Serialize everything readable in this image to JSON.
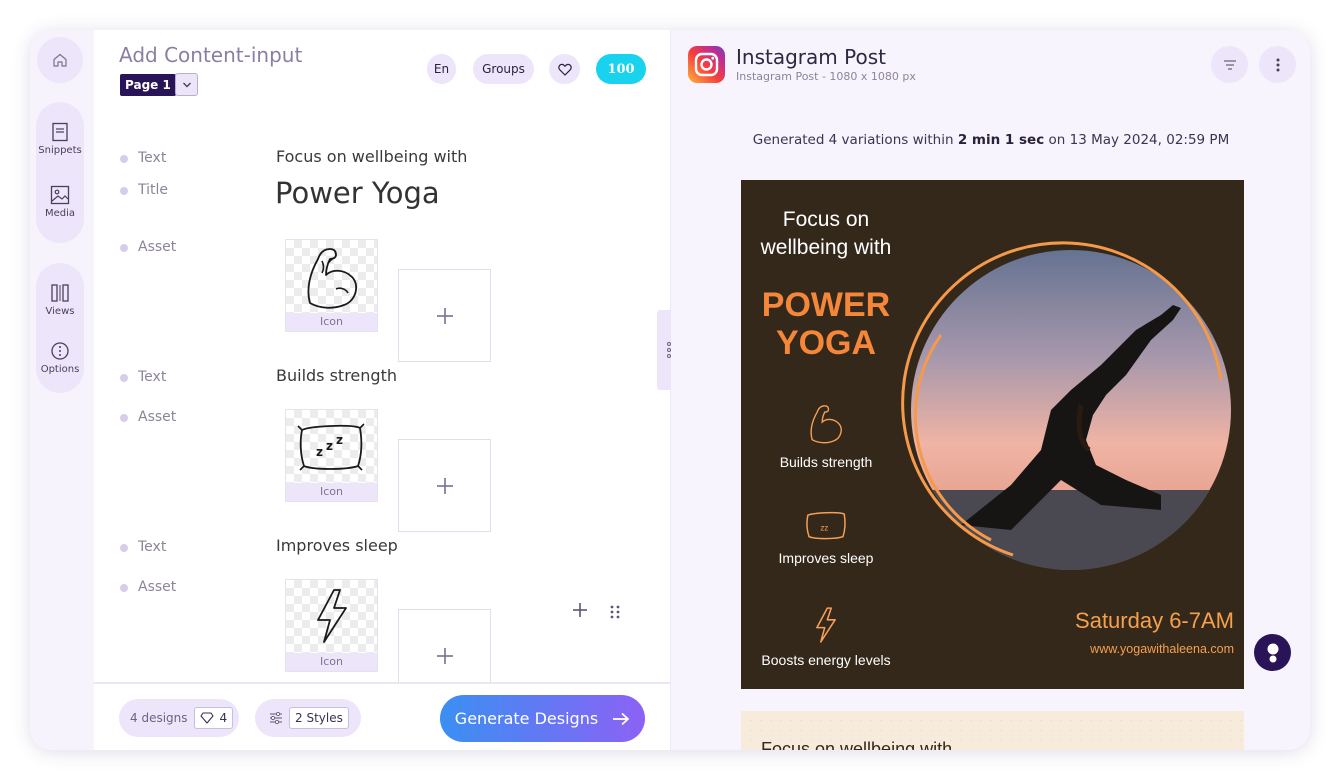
{
  "rail": {
    "items": [
      {
        "label": "Snippets",
        "icon": "snippets-icon"
      },
      {
        "label": "Media",
        "icon": "media-icon"
      },
      {
        "label": "Views",
        "icon": "views-icon"
      },
      {
        "label": "Options",
        "icon": "options-icon"
      }
    ]
  },
  "editor": {
    "title": "Add Content-input",
    "page_label": "Page 1",
    "language": "En",
    "groups_label": "Groups",
    "credits": "100",
    "asset_caption": "Icon",
    "fields": [
      {
        "type": "Text",
        "value": "Focus on wellbeing with"
      },
      {
        "type": "Title",
        "value": "Power Yoga"
      },
      {
        "type": "Asset",
        "icon": "flexed-arm-icon"
      },
      {
        "type": "Text",
        "value": "Builds strength"
      },
      {
        "type": "Asset",
        "icon": "pillow-sleep-icon"
      },
      {
        "type": "Text",
        "value": "Improves sleep"
      },
      {
        "type": "Asset",
        "icon": "lightning-icon"
      }
    ]
  },
  "footer": {
    "designs_label": "4 designs",
    "designs_count": "4",
    "styles_label": "2 Styles",
    "generate_label": "Generate Designs"
  },
  "preview": {
    "title": "Instagram Post",
    "subtitle": "Instagram Post - 1080 x 1080 px",
    "gen_prefix": "Generated 4  variations within",
    "gen_time": "2 min 1 sec",
    "gen_suffix": "on 13 May 2024, 02:59 PM"
  },
  "poster": {
    "headline_1": "Focus on",
    "headline_2": "wellbeing with",
    "title_1": "POWER",
    "title_2": "YOGA",
    "features": [
      "Builds strength",
      "Improves sleep",
      "Boosts energy levels"
    ],
    "date": "Saturday 6-7AM",
    "url": "www.yogawithaleena.com",
    "accent": "#f5873a",
    "background": "#33281a"
  },
  "poster2": {
    "headline": "Focus on wellbeing with"
  },
  "colors": {
    "brand_dark": "#2a1458",
    "credits": "#19d3ee",
    "gradient_start": "#3a8ff2",
    "gradient_end": "#8c62f5"
  }
}
